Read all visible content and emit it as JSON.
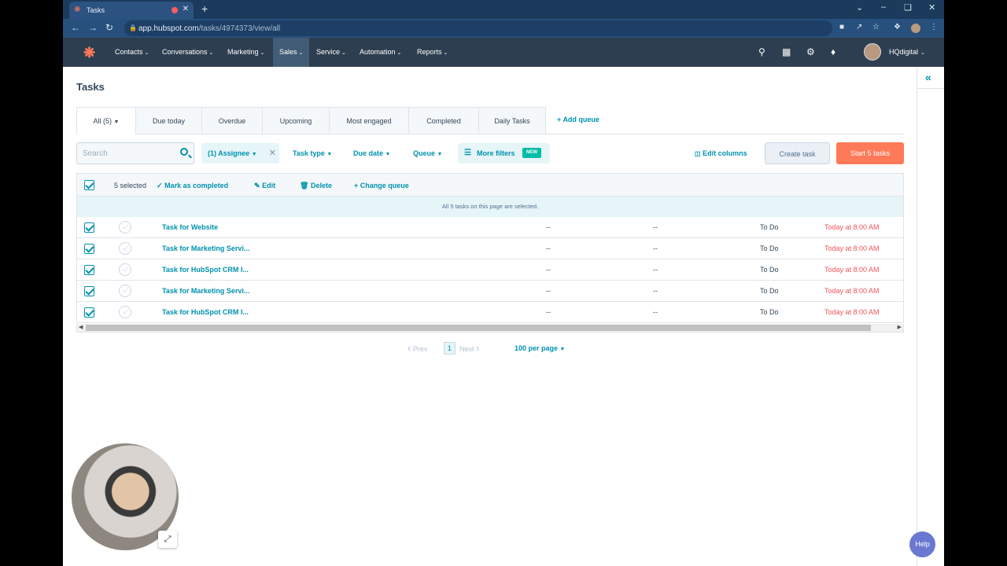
{
  "browser": {
    "tab_title": "Tasks",
    "new_tab": "+",
    "url_host": "app.hubspot.com",
    "url_path": "/tasks/4974373/view/all"
  },
  "nav": {
    "items": [
      "Contacts",
      "Conversations",
      "Marketing",
      "Sales",
      "Service",
      "Automation",
      "Reports"
    ],
    "active": "Sales",
    "account": "HQdigital"
  },
  "page": {
    "title": "Tasks",
    "tabs": [
      "All (5)",
      "Due today",
      "Overdue",
      "Upcoming",
      "Most engaged",
      "Completed",
      "Daily Tasks"
    ],
    "add_queue": "Add queue"
  },
  "filters": {
    "search_placeholder": "Search",
    "assignee_chip": "(1) Assignee",
    "task_type": "Task type",
    "due_date": "Due date",
    "queue": "Queue",
    "more_filters": "More filters",
    "new_badge": "NEW",
    "edit_columns": "Edit columns",
    "create_task": "Create task",
    "start_tasks": "Start 5 tasks"
  },
  "bulk": {
    "selected": "5 selected",
    "mark_completed": "Mark as completed",
    "edit": "Edit",
    "delete": "Delete",
    "change_queue": "Change queue",
    "note": "All 5 tasks on this page are selected."
  },
  "rows": [
    {
      "name": "Task for Website",
      "c1": "--",
      "c2": "--",
      "status": "To Do",
      "due": "Today at 8:00 AM"
    },
    {
      "name": "Task for Marketing Servi...",
      "c1": "--",
      "c2": "--",
      "status": "To Do",
      "due": "Today at 8:00 AM"
    },
    {
      "name": "Task for HubSpot CRM I...",
      "c1": "--",
      "c2": "--",
      "status": "To Do",
      "due": "Today at 8:00 AM"
    },
    {
      "name": "Task for Marketing Servi...",
      "c1": "--",
      "c2": "--",
      "status": "To Do",
      "due": "Today at 8:00 AM"
    },
    {
      "name": "Task for HubSpot CRM I...",
      "c1": "--",
      "c2": "--",
      "status": "To Do",
      "due": "Today at 8:00 AM"
    }
  ],
  "pager": {
    "prev": "Prev",
    "current": "1",
    "next": "Next",
    "per_page": "100 per page"
  },
  "help": "Help",
  "colors": {
    "nav_bg": "#2d3e50",
    "accent": "#0091ae",
    "primary_btn": "#ff7a59",
    "due_red": "#f2545b"
  }
}
